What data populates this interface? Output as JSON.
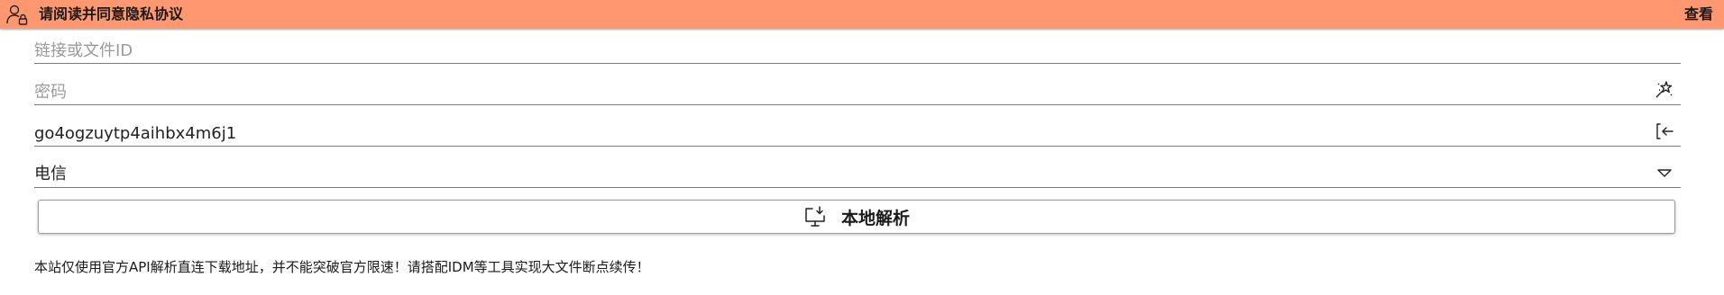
{
  "banner": {
    "title": "请阅读并同意隐私协议",
    "view_label": "查看",
    "background": "#FF9770",
    "icon": "person-lock-icon"
  },
  "form": {
    "link": {
      "placeholder": "链接或文件ID",
      "value": ""
    },
    "password": {
      "placeholder": "密码",
      "value": "",
      "trailing_icon": "magic-wand-icon"
    },
    "token": {
      "value": "go4ogzuytp4aihbx4m6j1",
      "trailing_icon": "sign-in-icon"
    },
    "carrier": {
      "selected": "电信",
      "trailing_icon": "chevron-down-icon"
    }
  },
  "action": {
    "label": "本地解析",
    "icon": "monitor-download-icon"
  },
  "notice": "本站仅使用官方API解析直连下载地址，并不能突破官方限速！请搭配IDM等工具实现大文件断点续传！"
}
